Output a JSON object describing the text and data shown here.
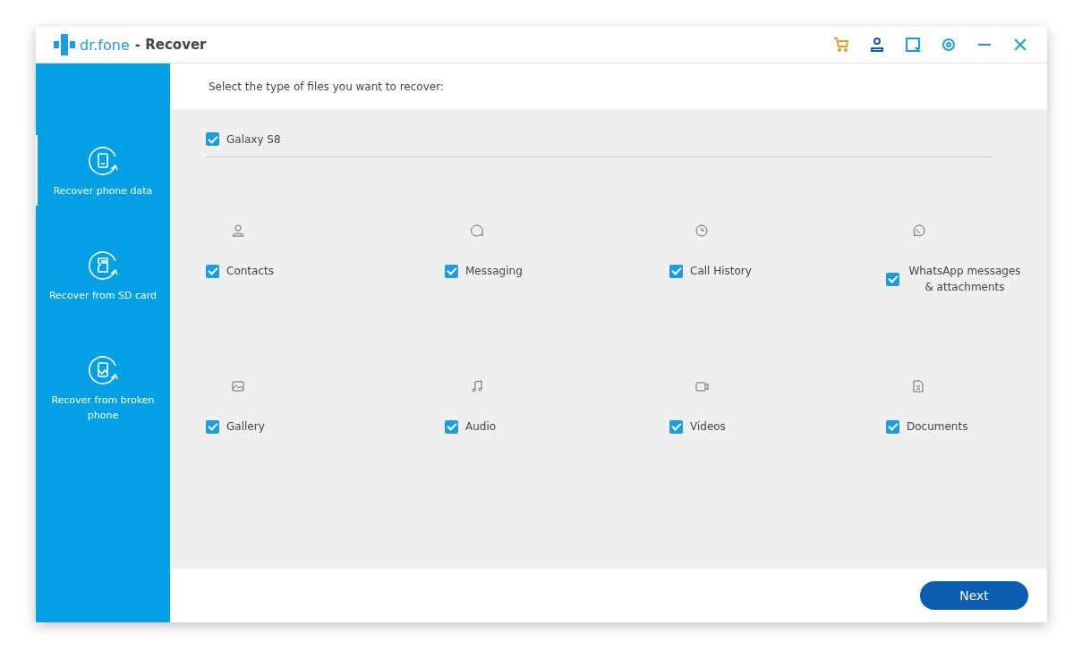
{
  "window": {
    "brand": "dr.fone",
    "title": "- Recover"
  },
  "toolbar": [
    {
      "kind": "cart"
    },
    {
      "kind": "account"
    },
    {
      "kind": "feedback"
    },
    {
      "kind": "settings"
    },
    {
      "kind": "minimize"
    },
    {
      "kind": "close"
    }
  ],
  "sidebar": {
    "items": [
      {
        "label": "Recover phone data",
        "kind": "phone",
        "selected": true
      },
      {
        "label": "Recover from SD card",
        "kind": "sdcard",
        "selected": false
      },
      {
        "label": "Recover from broken phone",
        "kind": "broken",
        "selected": false
      }
    ]
  },
  "instruction": "Select the type of files you want to recover:",
  "device": {
    "label": "Galaxy S8",
    "checked": true
  },
  "file_types": [
    {
      "label": "Contacts",
      "kind": "contacts",
      "checked": true
    },
    {
      "label": "Messaging",
      "kind": "messaging",
      "checked": true
    },
    {
      "label": "Call History",
      "kind": "calls",
      "checked": true
    },
    {
      "label": "WhatsApp messages & attachments",
      "kind": "whatsapp",
      "checked": true
    },
    {
      "label": "Gallery",
      "kind": "gallery",
      "checked": true
    },
    {
      "label": "Audio",
      "kind": "audio",
      "checked": true
    },
    {
      "label": "Videos",
      "kind": "videos",
      "checked": true
    },
    {
      "label": "Documents",
      "kind": "documents",
      "checked": true
    }
  ],
  "next_button": "Next"
}
